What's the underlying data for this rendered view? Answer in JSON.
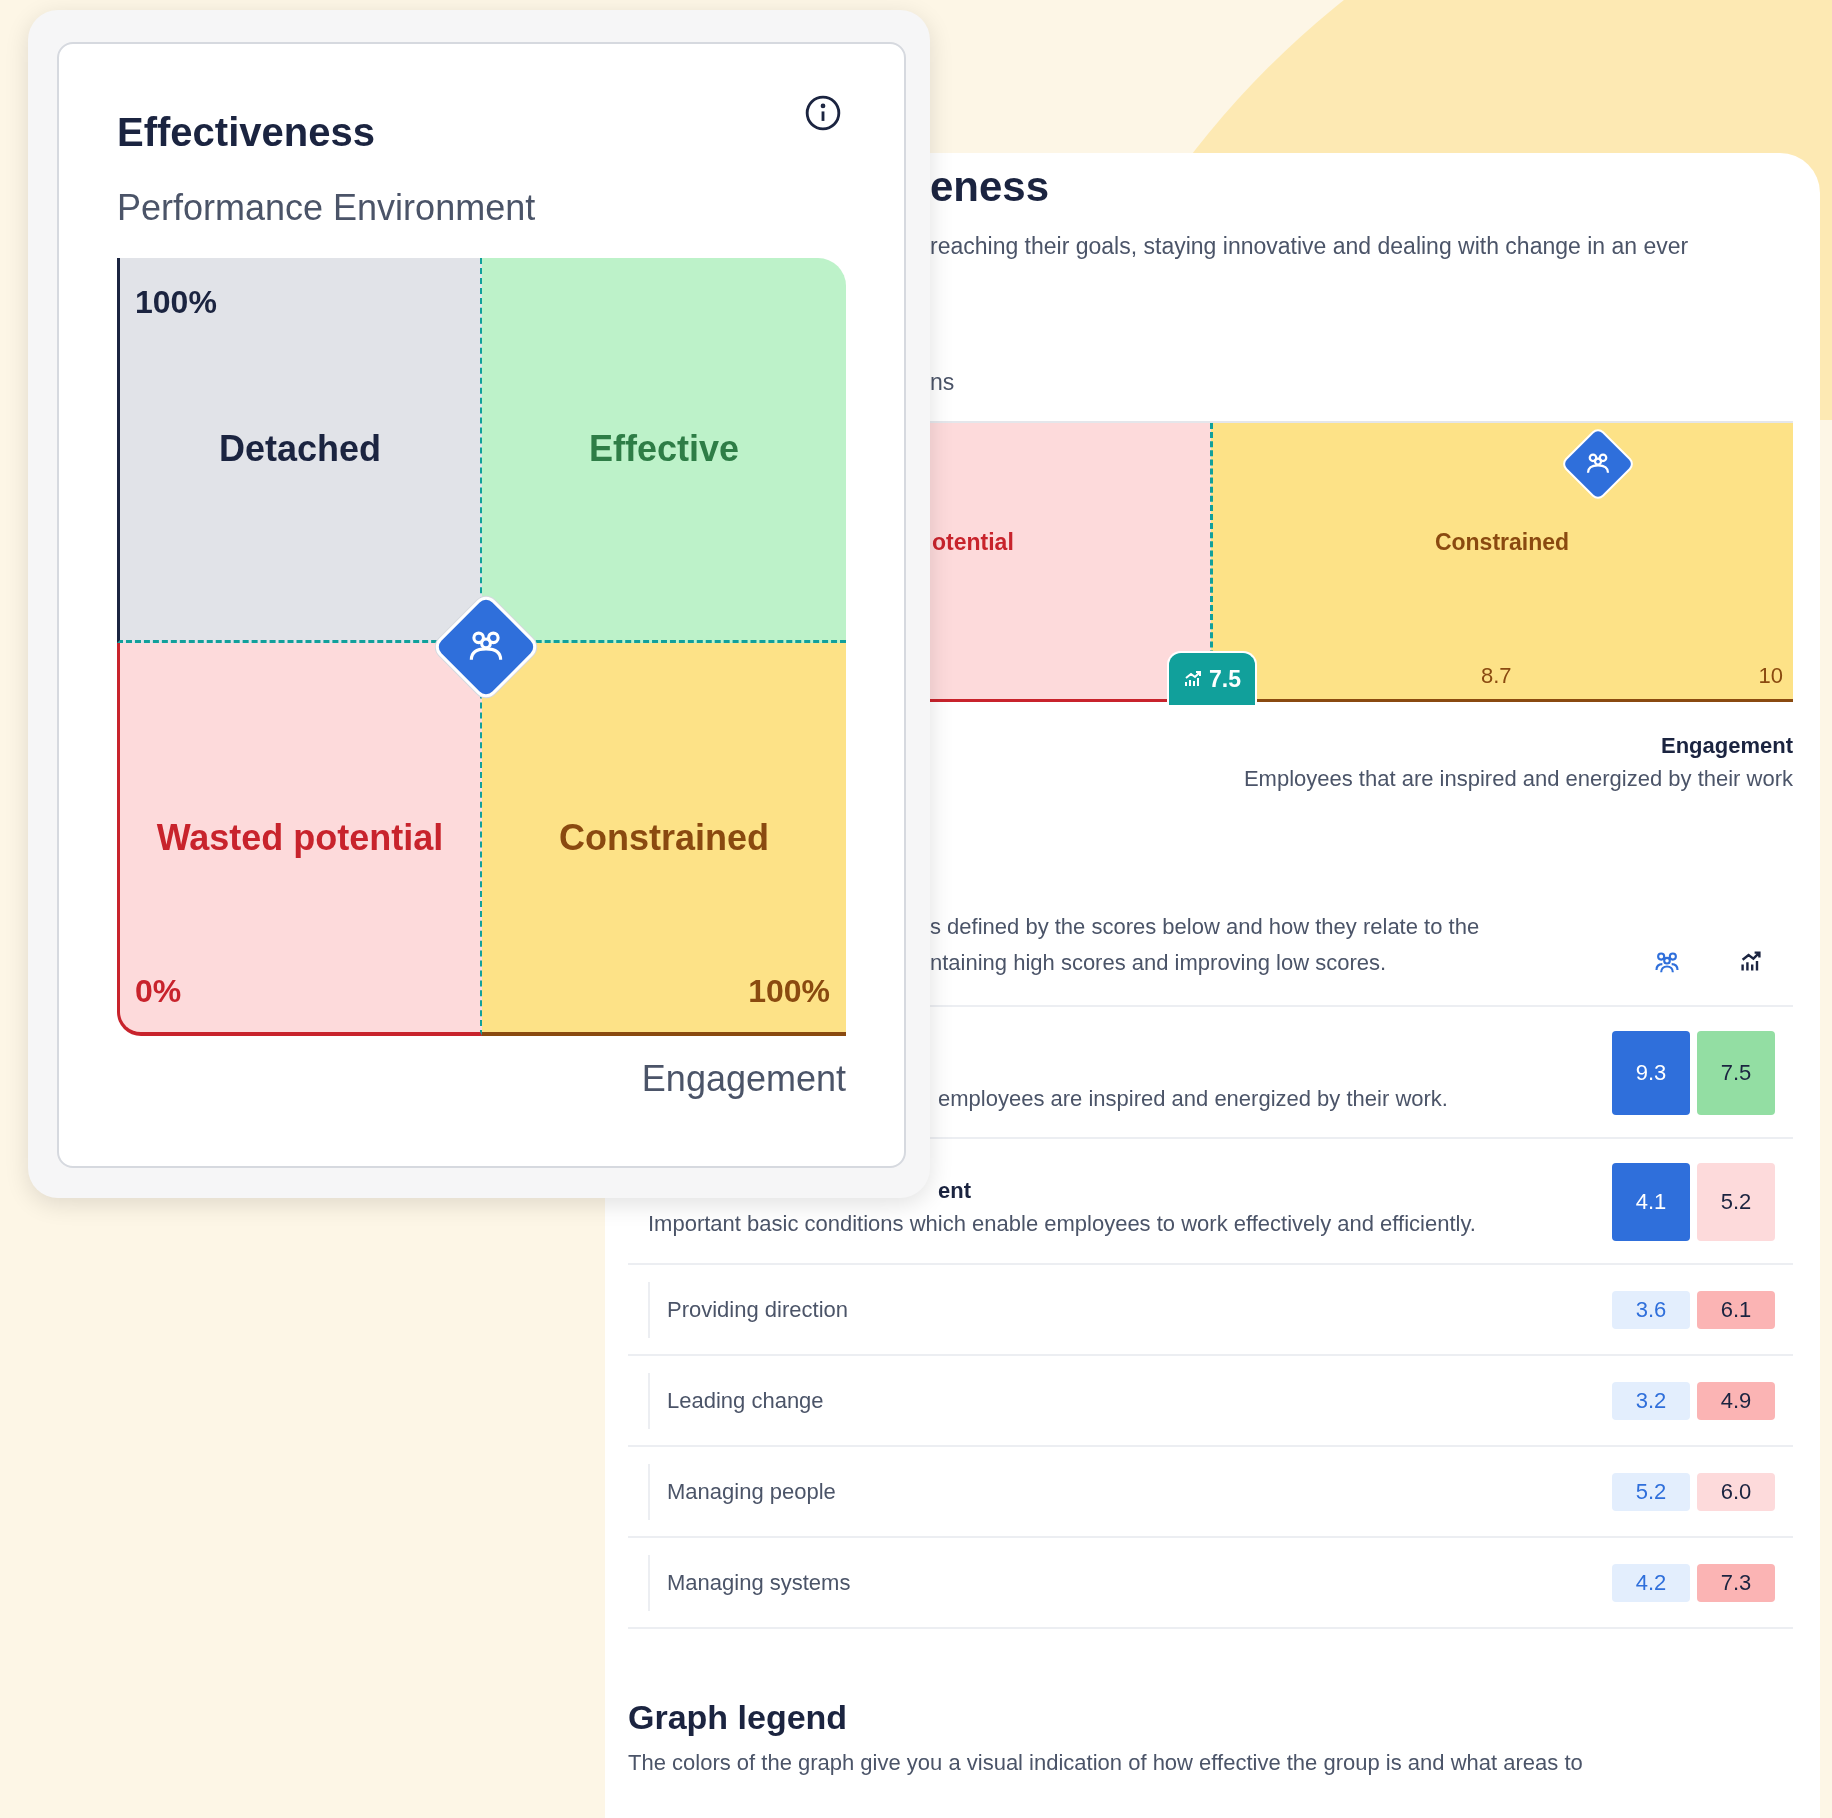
{
  "back_card": {
    "title": "eness",
    "description": "reaching their goals, staying innovative and dealing with change in an ever",
    "section_label": "ns",
    "chart": {
      "segments": [
        {
          "label": "otential",
          "kind": "wasted"
        },
        {
          "label": "Constrained",
          "kind": "constrained"
        }
      ],
      "ticks": [
        "8.7",
        "10"
      ],
      "benchmark_badge": "7.5"
    },
    "axis": {
      "title": "Engagement",
      "description": "Employees that are inspired and energized by their work"
    },
    "intro": [
      "s defined by the scores below and how they relate to the",
      "ntaining high scores and improving low scores."
    ],
    "rows": [
      {
        "kind": "main",
        "description": "employees are inspired and energized by their work.",
        "group": {
          "value": "9.3",
          "kind": "solid"
        },
        "benchmark": {
          "value": "7.5",
          "kind": "good"
        }
      },
      {
        "kind": "main",
        "title": "ent",
        "description": "Important basic conditions which enable employees to work effectively and efficiently.",
        "group": {
          "value": "4.1",
          "kind": "solid"
        },
        "benchmark": {
          "value": "5.2",
          "kind": "fair"
        }
      },
      {
        "kind": "sub",
        "title": "Providing direction",
        "group": {
          "value": "3.6",
          "kind": "light"
        },
        "benchmark": {
          "value": "6.1",
          "kind": "poor"
        }
      },
      {
        "kind": "sub",
        "title": "Leading change",
        "group": {
          "value": "3.2",
          "kind": "light"
        },
        "benchmark": {
          "value": "4.9",
          "kind": "poor"
        }
      },
      {
        "kind": "sub",
        "title": "Managing people",
        "group": {
          "value": "5.2",
          "kind": "light"
        },
        "benchmark": {
          "value": "6.0",
          "kind": "fair"
        }
      },
      {
        "kind": "sub",
        "title": "Managing systems",
        "group": {
          "value": "4.2",
          "kind": "light"
        },
        "benchmark": {
          "value": "7.3",
          "kind": "poor"
        }
      }
    ],
    "legend": {
      "title": "Graph legend",
      "text": "The colors of the graph give you a visual indication of how effective the group is and what areas to"
    }
  },
  "front_card": {
    "title": "Effectiveness",
    "subtitle": "Performance Environment",
    "quadrants": [
      {
        "label": "Detached",
        "kind": "detached",
        "corner": "100%"
      },
      {
        "label": "Effective",
        "kind": "effective"
      },
      {
        "label": "Wasted potential",
        "kind": "wasted",
        "corner": "0%"
      },
      {
        "label": "Constrained",
        "kind": "constrained",
        "corner": "100%"
      }
    ],
    "x_axis_label": "Engagement"
  }
}
